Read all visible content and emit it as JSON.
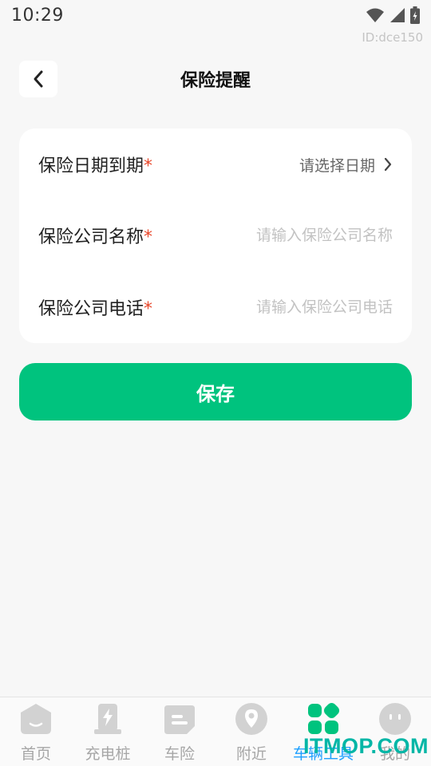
{
  "status_bar": {
    "time": "10:29"
  },
  "watermark_id": "ID:dce150",
  "header": {
    "title": "保险提醒"
  },
  "form": {
    "date_row": {
      "label": "保险日期到期",
      "required": "*",
      "placeholder": "请选择日期"
    },
    "company_row": {
      "label": "保险公司名称",
      "required": "*",
      "placeholder": "请输入保险公司名称",
      "value": ""
    },
    "phone_row": {
      "label": "保险公司电话",
      "required": "*",
      "placeholder": "请输入保险公司电话",
      "value": ""
    }
  },
  "save_label": "保存",
  "tabs": [
    {
      "label": "首页",
      "icon": "home-icon"
    },
    {
      "label": "充电桩",
      "icon": "charging-pile-icon"
    },
    {
      "label": "车险",
      "icon": "car-insurance-icon"
    },
    {
      "label": "附近",
      "icon": "location-pin-icon"
    },
    {
      "label": "车辆工具",
      "icon": "apps-grid-icon",
      "active": true
    },
    {
      "label": "我的",
      "icon": "profile-face-icon"
    }
  ],
  "site_watermark": "ITMOP.COM",
  "colors": {
    "accent": "#00c37e",
    "required": "#e8472b",
    "active_tab": "#1ea0ff",
    "background": "#f7f7f7"
  }
}
